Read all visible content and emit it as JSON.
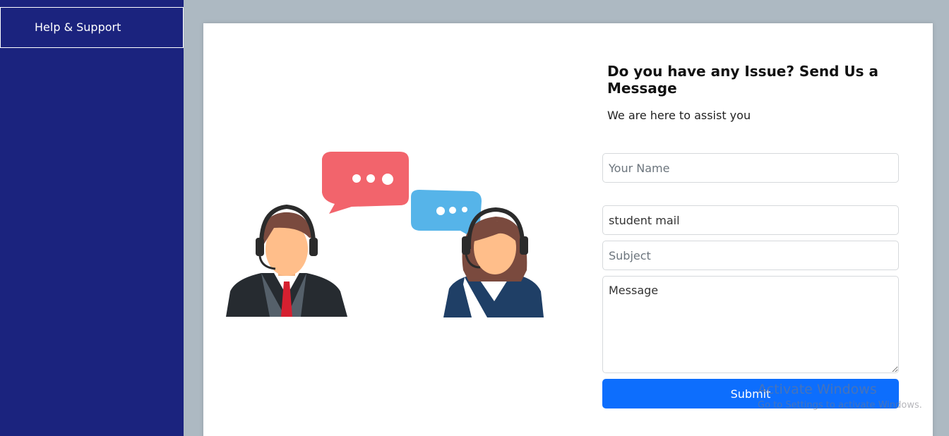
{
  "sidebar": {
    "items": [
      {
        "label": "Help & Support"
      }
    ]
  },
  "contact": {
    "heading": "Do you have any Issue? Send Us a Message",
    "subheading": "We are here to assist you",
    "fields": {
      "name_placeholder": "Your Name",
      "email_placeholder": "student mail",
      "subject_placeholder": "Subject",
      "message_placeholder": "Message"
    },
    "submit_label": "Submit"
  },
  "illustration": {
    "icon": "customer-support-agents-illustration"
  },
  "watermark": {
    "title": "Activate Windows",
    "subtitle": "Go to Settings to activate Windows."
  },
  "colors": {
    "sidebar": "#1b237e",
    "page_background": "#adb9c2",
    "primary_button": "#0d6efd",
    "bubble_red": "#f2646c",
    "bubble_blue": "#56b4e9"
  }
}
